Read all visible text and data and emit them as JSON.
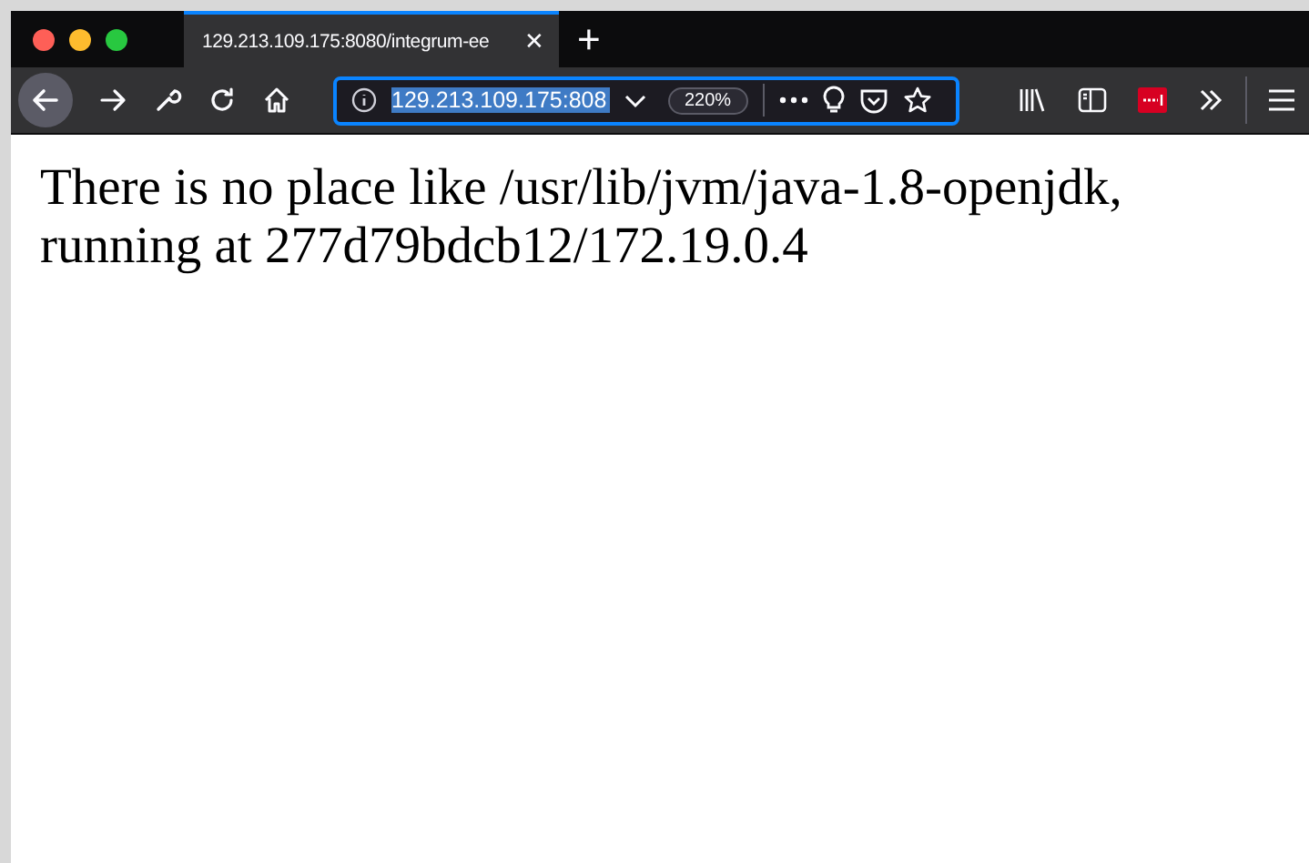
{
  "tab": {
    "title": "129.213.109.175:8080/integrum-ee",
    "close": "✕",
    "selected": true
  },
  "new_tab": "+",
  "address_bar": {
    "url": "129.213.109.175:808",
    "zoom": "220%"
  },
  "page": {
    "text": "There is no place like /usr/lib/jvm/java-1.8-openjdk, running at 277d79bdcb12/172.19.0.4"
  }
}
